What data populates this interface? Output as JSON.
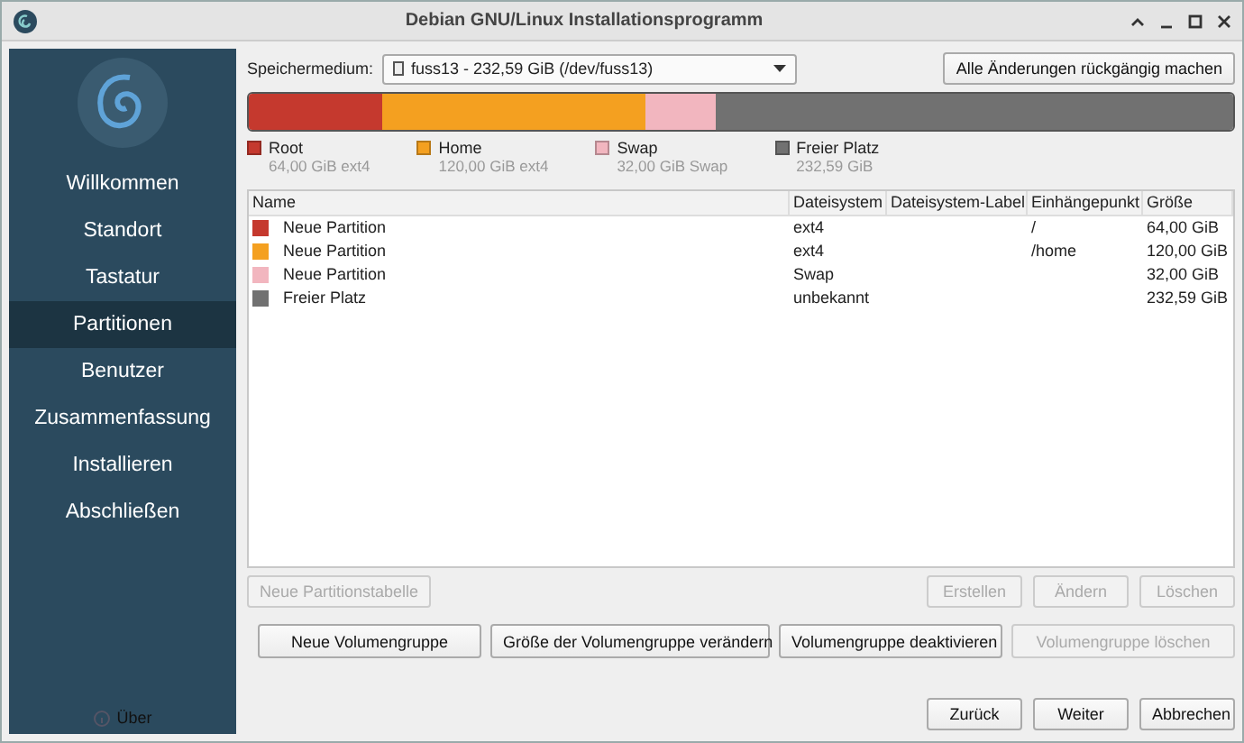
{
  "window": {
    "title": "Debian GNU/Linux Installationsprogramm"
  },
  "sidebar": {
    "items": [
      {
        "label": "Willkommen",
        "selected": false
      },
      {
        "label": "Standort",
        "selected": false
      },
      {
        "label": "Tastatur",
        "selected": false
      },
      {
        "label": "Partitionen",
        "selected": true
      },
      {
        "label": "Benutzer",
        "selected": false
      },
      {
        "label": "Zusammenfassung",
        "selected": false
      },
      {
        "label": "Installieren",
        "selected": false
      },
      {
        "label": "Abschließen",
        "selected": false
      }
    ],
    "about": "Über"
  },
  "storage": {
    "label": "Speichermedium:",
    "value": "fuss13 - 232,59 GiB (/dev/fuss13)",
    "revert_button": "Alle Änderungen rückgängig machen"
  },
  "usage_bar": [
    {
      "name": "Root",
      "detail": "64,00 GiB ext4",
      "color": "#c5392e"
    },
    {
      "name": "Home",
      "detail": "120,00 GiB ext4",
      "color": "#f4a020"
    },
    {
      "name": "Swap",
      "detail": "32,00 GiB Swap",
      "color": "#f2b6bf"
    },
    {
      "name": "Freier Platz",
      "detail": "232,59 GiB",
      "color": "#717171"
    }
  ],
  "table": {
    "columns": [
      "Name",
      "Dateisystem",
      "Dateisystem-Label",
      "Einhängepunkt",
      "Größe"
    ],
    "rows": [
      {
        "color": "#c5392e",
        "name": "Neue Partition",
        "filesystem": "ext4",
        "mount": "/",
        "size": "64,00 GiB"
      },
      {
        "color": "#f4a020",
        "name": "Neue Partition",
        "filesystem": "ext4",
        "mount": "/home",
        "size": "120,00 GiB"
      },
      {
        "color": "#f2b6bf",
        "name": "Neue Partition",
        "filesystem": "Swap",
        "mount": "",
        "size": "32,00 GiB"
      },
      {
        "color": "#717171",
        "name": "Freier Platz",
        "filesystem": "unbekannt",
        "mount": "",
        "size": "232,59 GiB"
      }
    ]
  },
  "partition_buttons": [
    {
      "label": "Neue Partitionstabelle",
      "disabled": true
    },
    {
      "label": "Erstellen",
      "disabled": true
    },
    {
      "label": "Ändern",
      "disabled": true
    },
    {
      "label": "Löschen",
      "disabled": true
    }
  ],
  "volume_buttons": [
    {
      "label": "Neue Volumengruppe",
      "disabled": false
    },
    {
      "label": "Größe der Volumengruppe verändern",
      "disabled": false
    },
    {
      "label": "Volumengruppe deaktivieren",
      "disabled": false
    },
    {
      "label": "Volumengruppe löschen",
      "disabled": true
    }
  ],
  "nav_buttons": [
    {
      "label": "Zurück",
      "disabled": false
    },
    {
      "label": "Weiter",
      "disabled": false
    },
    {
      "label": "Abbrechen",
      "disabled": false
    }
  ]
}
